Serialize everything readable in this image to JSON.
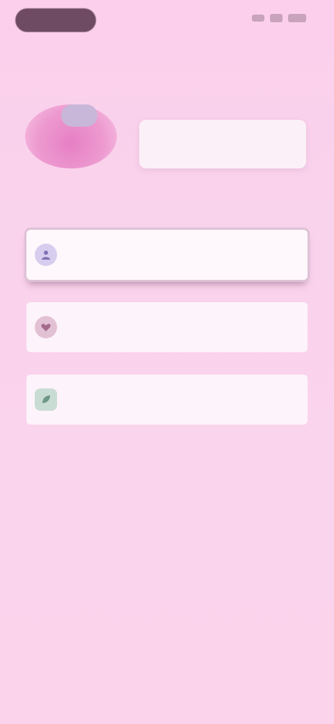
{
  "status_bar": {
    "pill_label": "",
    "icons": [
      "signal-icon",
      "wifi-icon",
      "battery-icon"
    ]
  },
  "header": {
    "title": ""
  },
  "profile": {
    "avatar_icon": "avatar-icon",
    "name": "",
    "subtitle": ""
  },
  "options": [
    {
      "label": "",
      "icon": "user-icon",
      "selected": true
    },
    {
      "label": "",
      "icon": "heart-icon",
      "selected": false
    },
    {
      "label": "",
      "icon": "leaf-icon",
      "selected": false
    }
  ],
  "colors": {
    "background": "#fcd0ec",
    "accent": "#e67fc4",
    "card": "#fdf3fa",
    "dark_pill": "#6f4a63"
  }
}
